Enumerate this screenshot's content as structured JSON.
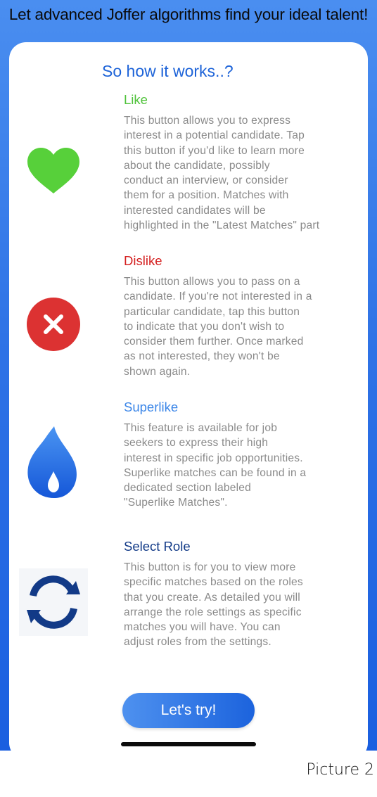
{
  "header": {
    "headline": "Let advanced Joffer algorithms find your ideal talent!"
  },
  "card": {
    "title": "So how it works..?",
    "items": [
      {
        "title": "Like",
        "color": "#4fc23a",
        "icon": "heart-icon",
        "description": "This button allows you to express\ninterest in a potential candidate. Tap\nthis button if you'd like to learn more\nabout the candidate, possibly\nconduct an interview, or consider\nthem for a position. Matches with\ninterested candidates will be\nhighlighted in the \"Latest Matches\" part"
      },
      {
        "title": "Dislike",
        "color": "#d41f1f",
        "icon": "close-circle-icon",
        "description": "This button allows you to pass on a\ncandidate. If you're not interested in a\nparticular candidate, tap this button\nto indicate that you don't wish to\nconsider them further. Once marked\nas not interested, they won't be\nshown again."
      },
      {
        "title": "Superlike",
        "color": "#3b86e8",
        "icon": "flame-icon",
        "description": "This feature is available for job\nseekers to express their high\ninterest in specific job opportunities.\nSuperlike matches can be found in a\ndedicated section labeled\n\"Superlike Matches\"."
      },
      {
        "title": "Select Role",
        "color": "#123a87",
        "icon": "refresh-icon",
        "description": "This button is for you to view more\nspecific matches based on the roles\nthat you create. As detailed you will\narrange the role settings as specific\nmatches you will have. You can\nadjust roles from the settings."
      }
    ],
    "cta_label": "Let's try!"
  },
  "caption": "Picture 2"
}
